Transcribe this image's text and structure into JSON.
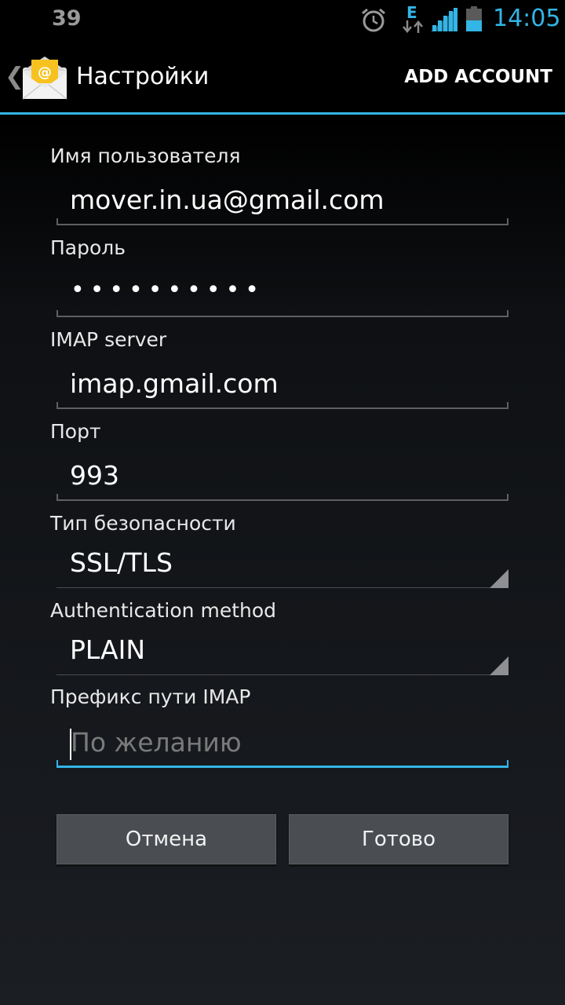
{
  "status_bar": {
    "notification_count": "39",
    "data_indicator": "E",
    "time": "14:05"
  },
  "action_bar": {
    "title": "Настройки",
    "action": "ADD ACCOUNT",
    "icon": "email-app-icon"
  },
  "form": {
    "username": {
      "label": "Имя пользователя",
      "value": "mover.in.ua@gmail.com"
    },
    "password": {
      "label": "Пароль",
      "value": "••••••••••"
    },
    "imap_server": {
      "label": "IMAP server",
      "value": "imap.gmail.com"
    },
    "port": {
      "label": "Порт",
      "value": "993"
    },
    "security_type": {
      "label": "Тип безопасности",
      "value": "SSL/TLS"
    },
    "auth_method": {
      "label": "Authentication method",
      "value": "PLAIN"
    },
    "imap_prefix": {
      "label": "Префикс пути IMAP",
      "placeholder": "По желанию"
    }
  },
  "buttons": {
    "cancel": "Отмена",
    "done": "Готово"
  },
  "colors": {
    "accent": "#33b5e5",
    "background": "#000000"
  }
}
